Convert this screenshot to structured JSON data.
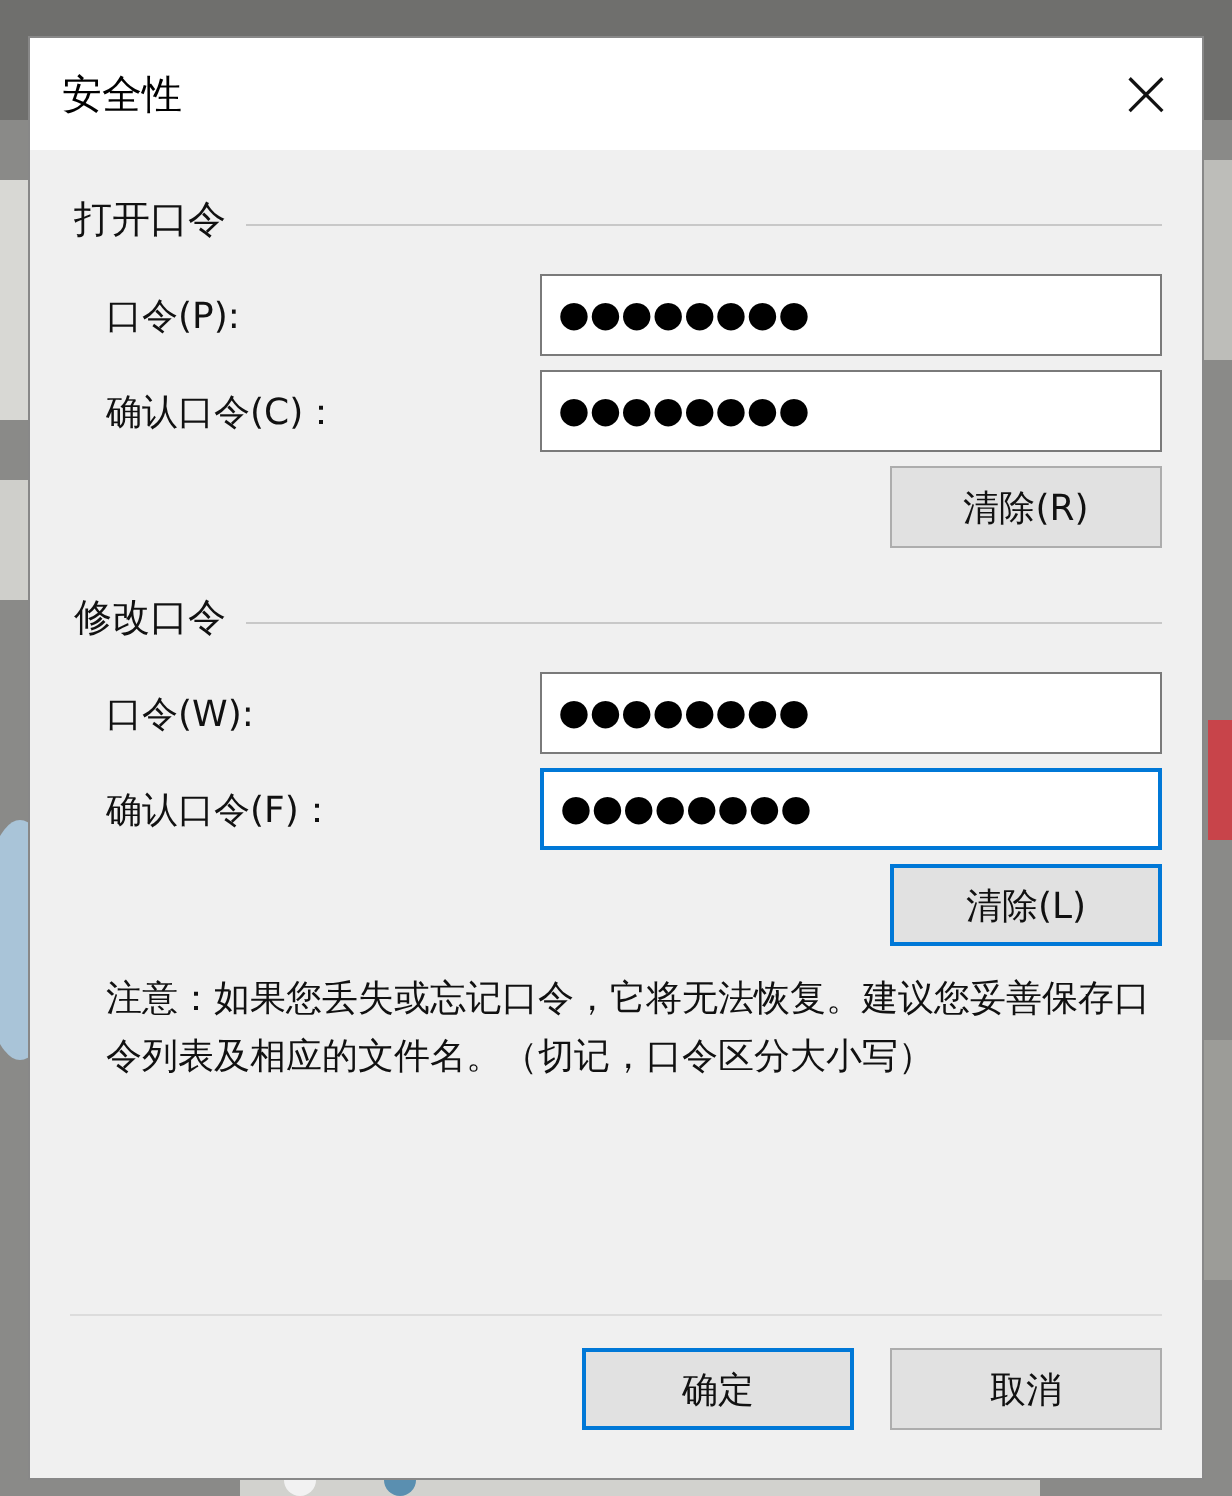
{
  "window": {
    "title": "安全性",
    "close": "×"
  },
  "sections": [
    {
      "title": "打开口令",
      "fields": [
        {
          "label": "口令(P):",
          "value": "●●●●●●●●",
          "focused": false
        },
        {
          "label": "确认口令(C)：",
          "value": "●●●●●●●●",
          "focused": false
        }
      ],
      "clear_button": {
        "label": "清除(R)",
        "focused": false
      }
    },
    {
      "title": "修改口令",
      "fields": [
        {
          "label": "口令(W):",
          "value": "●●●●●●●●",
          "focused": false
        },
        {
          "label": "确认口令(F)：",
          "value": "●●●●●●●●",
          "focused": true
        }
      ],
      "clear_button": {
        "label": "清除(L)",
        "focused": true
      }
    }
  ],
  "note": "注意：如果您丢失或忘记口令，它将无法恢复。建议您妥善保存口令列表及相应的文件名。（切记，口令区分大小写）",
  "buttons": [
    {
      "label": "确定",
      "focused": true
    },
    {
      "label": "取消",
      "focused": false
    }
  ]
}
